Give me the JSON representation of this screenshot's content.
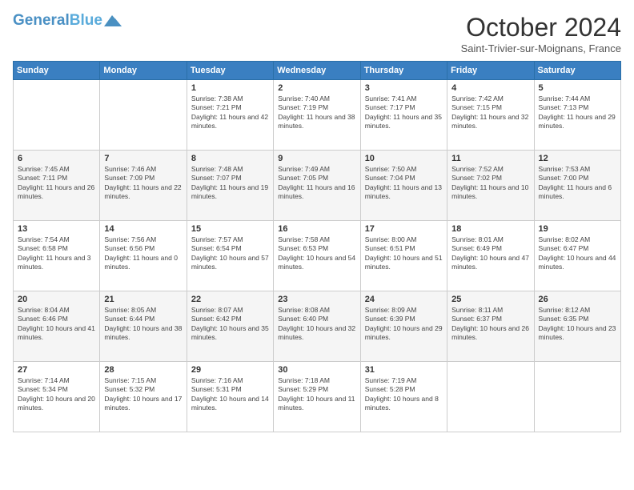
{
  "logo": {
    "line1": "General",
    "line2": "Blue"
  },
  "title": "October 2024",
  "subtitle": "Saint-Trivier-sur-Moignans, France",
  "days_of_week": [
    "Sunday",
    "Monday",
    "Tuesday",
    "Wednesday",
    "Thursday",
    "Friday",
    "Saturday"
  ],
  "weeks": [
    [
      {
        "day": "",
        "content": ""
      },
      {
        "day": "",
        "content": ""
      },
      {
        "day": "1",
        "content": "Sunrise: 7:38 AM\nSunset: 7:21 PM\nDaylight: 11 hours and 42 minutes."
      },
      {
        "day": "2",
        "content": "Sunrise: 7:40 AM\nSunset: 7:19 PM\nDaylight: 11 hours and 38 minutes."
      },
      {
        "day": "3",
        "content": "Sunrise: 7:41 AM\nSunset: 7:17 PM\nDaylight: 11 hours and 35 minutes."
      },
      {
        "day": "4",
        "content": "Sunrise: 7:42 AM\nSunset: 7:15 PM\nDaylight: 11 hours and 32 minutes."
      },
      {
        "day": "5",
        "content": "Sunrise: 7:44 AM\nSunset: 7:13 PM\nDaylight: 11 hours and 29 minutes."
      }
    ],
    [
      {
        "day": "6",
        "content": "Sunrise: 7:45 AM\nSunset: 7:11 PM\nDaylight: 11 hours and 26 minutes."
      },
      {
        "day": "7",
        "content": "Sunrise: 7:46 AM\nSunset: 7:09 PM\nDaylight: 11 hours and 22 minutes."
      },
      {
        "day": "8",
        "content": "Sunrise: 7:48 AM\nSunset: 7:07 PM\nDaylight: 11 hours and 19 minutes."
      },
      {
        "day": "9",
        "content": "Sunrise: 7:49 AM\nSunset: 7:05 PM\nDaylight: 11 hours and 16 minutes."
      },
      {
        "day": "10",
        "content": "Sunrise: 7:50 AM\nSunset: 7:04 PM\nDaylight: 11 hours and 13 minutes."
      },
      {
        "day": "11",
        "content": "Sunrise: 7:52 AM\nSunset: 7:02 PM\nDaylight: 11 hours and 10 minutes."
      },
      {
        "day": "12",
        "content": "Sunrise: 7:53 AM\nSunset: 7:00 PM\nDaylight: 11 hours and 6 minutes."
      }
    ],
    [
      {
        "day": "13",
        "content": "Sunrise: 7:54 AM\nSunset: 6:58 PM\nDaylight: 11 hours and 3 minutes."
      },
      {
        "day": "14",
        "content": "Sunrise: 7:56 AM\nSunset: 6:56 PM\nDaylight: 11 hours and 0 minutes."
      },
      {
        "day": "15",
        "content": "Sunrise: 7:57 AM\nSunset: 6:54 PM\nDaylight: 10 hours and 57 minutes."
      },
      {
        "day": "16",
        "content": "Sunrise: 7:58 AM\nSunset: 6:53 PM\nDaylight: 10 hours and 54 minutes."
      },
      {
        "day": "17",
        "content": "Sunrise: 8:00 AM\nSunset: 6:51 PM\nDaylight: 10 hours and 51 minutes."
      },
      {
        "day": "18",
        "content": "Sunrise: 8:01 AM\nSunset: 6:49 PM\nDaylight: 10 hours and 47 minutes."
      },
      {
        "day": "19",
        "content": "Sunrise: 8:02 AM\nSunset: 6:47 PM\nDaylight: 10 hours and 44 minutes."
      }
    ],
    [
      {
        "day": "20",
        "content": "Sunrise: 8:04 AM\nSunset: 6:46 PM\nDaylight: 10 hours and 41 minutes."
      },
      {
        "day": "21",
        "content": "Sunrise: 8:05 AM\nSunset: 6:44 PM\nDaylight: 10 hours and 38 minutes."
      },
      {
        "day": "22",
        "content": "Sunrise: 8:07 AM\nSunset: 6:42 PM\nDaylight: 10 hours and 35 minutes."
      },
      {
        "day": "23",
        "content": "Sunrise: 8:08 AM\nSunset: 6:40 PM\nDaylight: 10 hours and 32 minutes."
      },
      {
        "day": "24",
        "content": "Sunrise: 8:09 AM\nSunset: 6:39 PM\nDaylight: 10 hours and 29 minutes."
      },
      {
        "day": "25",
        "content": "Sunrise: 8:11 AM\nSunset: 6:37 PM\nDaylight: 10 hours and 26 minutes."
      },
      {
        "day": "26",
        "content": "Sunrise: 8:12 AM\nSunset: 6:35 PM\nDaylight: 10 hours and 23 minutes."
      }
    ],
    [
      {
        "day": "27",
        "content": "Sunrise: 7:14 AM\nSunset: 5:34 PM\nDaylight: 10 hours and 20 minutes."
      },
      {
        "day": "28",
        "content": "Sunrise: 7:15 AM\nSunset: 5:32 PM\nDaylight: 10 hours and 17 minutes."
      },
      {
        "day": "29",
        "content": "Sunrise: 7:16 AM\nSunset: 5:31 PM\nDaylight: 10 hours and 14 minutes."
      },
      {
        "day": "30",
        "content": "Sunrise: 7:18 AM\nSunset: 5:29 PM\nDaylight: 10 hours and 11 minutes."
      },
      {
        "day": "31",
        "content": "Sunrise: 7:19 AM\nSunset: 5:28 PM\nDaylight: 10 hours and 8 minutes."
      },
      {
        "day": "",
        "content": ""
      },
      {
        "day": "",
        "content": ""
      }
    ]
  ]
}
